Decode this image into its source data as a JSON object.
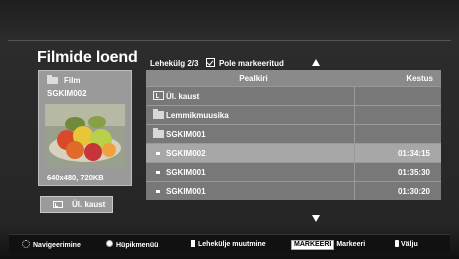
{
  "title": "Filmide loend",
  "page_info": {
    "page_label": "Lehekülg 2/3",
    "mark_status": "Pole markeeritud"
  },
  "preview": {
    "type_label": "Film",
    "file_name": "SGKIM002",
    "resolution": "640x480, 720KB"
  },
  "up_folder_button": {
    "label": "Ül. kaust"
  },
  "list": {
    "header_name": "Pealkiri",
    "header_duration": "Kestus",
    "rows": [
      {
        "icon": "up-folder-icon",
        "name": "Ül. kaust",
        "duration": ""
      },
      {
        "icon": "folder-icon",
        "name": "Lemmikmuusika",
        "duration": ""
      },
      {
        "icon": "folder-icon",
        "name": "SGKIM001",
        "duration": ""
      },
      {
        "icon": "file-icon",
        "name": "SGKIM002",
        "duration": "01:34:15",
        "selected": true
      },
      {
        "icon": "file-icon",
        "name": "SGKIM001",
        "duration": "01:35:30"
      },
      {
        "icon": "file-icon",
        "name": "SGKIM001",
        "duration": "01:30:20"
      }
    ]
  },
  "footer": {
    "navigate": "Navigeerimine",
    "popup_menu": "Hüpikmenüü",
    "page_change": "Lehekülje muutmine",
    "mark_key": "MARKEERI",
    "mark_label": "Markeeri",
    "exit": "Välju"
  },
  "colors": {
    "selected_row": "#a7a7a7",
    "row": "#787878",
    "header": "#8a8a8a",
    "background": "#262626"
  }
}
